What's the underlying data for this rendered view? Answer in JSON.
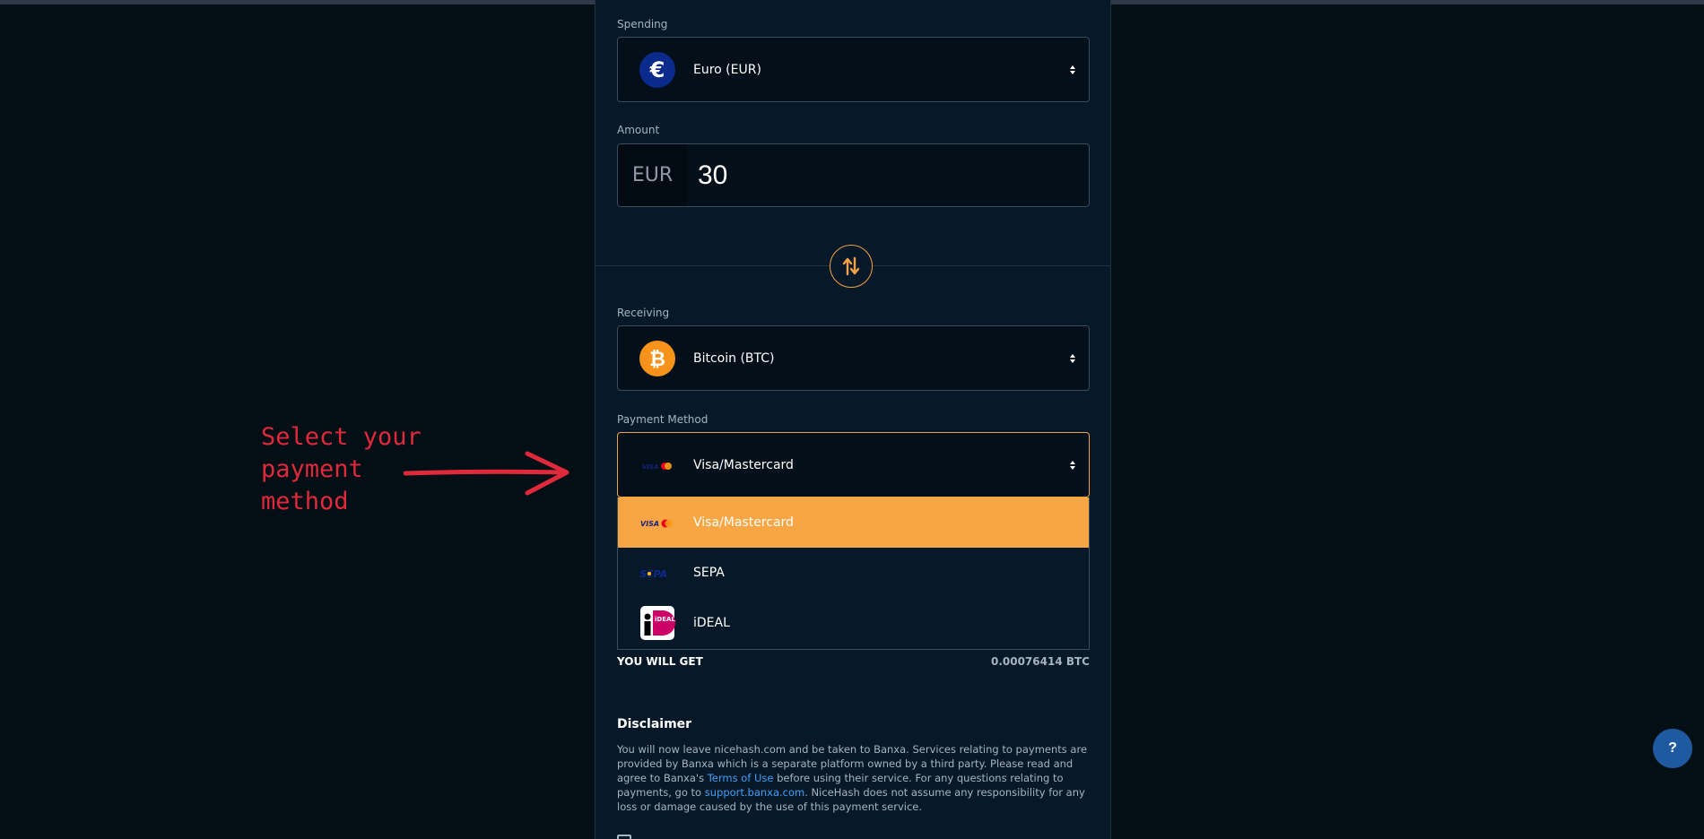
{
  "spending": {
    "label": "Spending",
    "currency": "Euro (EUR)",
    "icon": "euro-icon"
  },
  "amount": {
    "label": "Amount",
    "prefix": "EUR",
    "value": "30"
  },
  "swap": {
    "icon": "swap-arrows-icon"
  },
  "receiving": {
    "label": "Receiving",
    "currency": "Bitcoin (BTC)",
    "icon": "bitcoin-icon"
  },
  "payment": {
    "label": "Payment Method",
    "selected": "Visa/Mastercard",
    "options": [
      {
        "label": "Visa/Mastercard",
        "icon": "visa-mastercard-icon"
      },
      {
        "label": "SEPA",
        "icon": "sepa-icon"
      },
      {
        "label": "iDEAL",
        "icon": "ideal-icon"
      }
    ]
  },
  "result": {
    "label": "YOU WILL GET",
    "value": "0.00076414 BTC"
  },
  "disclaimer": {
    "title": "Disclaimer",
    "text_1": "You will now leave nicehash.com and be taken to Banxa. Services relating to payments are provided by Banxa which is a separate platform owned by a third party. Please read and agree to Banxa's ",
    "terms_link": "Terms of Use",
    "text_2": " before using their service. For any questions relating to payments, go to ",
    "support_link": "support.banxa.com",
    "text_3": ". NiceHash does not assume any responsibility for any loss or damage caused by the use of this payment service."
  },
  "annotation": {
    "line1": "Select your",
    "line2": "payment",
    "line3": "method"
  },
  "help": {
    "label": "?"
  },
  "colors": {
    "accent": "#f8a544",
    "annotation": "#e02a3b",
    "link": "#3f9ff7"
  }
}
